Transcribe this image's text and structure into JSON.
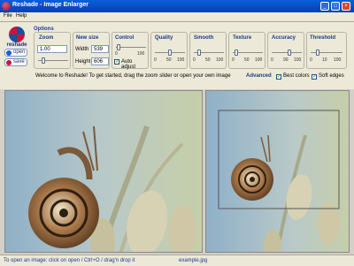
{
  "window": {
    "title": "Reshade - Image Enlarger"
  },
  "menu": {
    "file": "File",
    "help": "Help"
  },
  "sidebar": {
    "logo_text": "reshade",
    "open_label": "open",
    "save_label": "save"
  },
  "options": {
    "label": "Options",
    "zoom": {
      "label": "Zoom",
      "value": "1.00"
    },
    "newsize": {
      "label": "New size",
      "width_label": "Width",
      "width_value": "539",
      "height_label": "Height",
      "height_value": "606"
    },
    "control": {
      "label": "Control",
      "min": "0",
      "max": "100",
      "auto_adjust_label": "Auto adjust",
      "auto_adjust": true
    },
    "quality": {
      "label": "Quality",
      "ticks": [
        "0",
        "50",
        "100"
      ]
    },
    "smooth": {
      "label": "Smooth",
      "ticks": [
        "0",
        "50",
        "100"
      ]
    },
    "texture": {
      "label": "Texture",
      "ticks": [
        "0",
        "50",
        "100"
      ]
    },
    "accuracy": {
      "label": "Accuracy",
      "ticks": [
        "0",
        "90",
        "100"
      ]
    },
    "threshold": {
      "label": "Threshold",
      "ticks": [
        "0",
        "10",
        "100"
      ]
    }
  },
  "welcome_text": "Welcome to Reshade! To get started, drag the zoom slider or open your own image",
  "advanced": {
    "label": "Advanced",
    "best_colors_label": "Best colors",
    "best_colors": true,
    "soft_edges_label": "Soft edges",
    "soft_edges": true
  },
  "status": {
    "hint": "To open an image: click on open / Ctrl+O / drag'n drop it",
    "filename": "example.jpg"
  },
  "colors": {
    "title_bar": "#0a5fd8",
    "panel": "#ece9d8",
    "accent": "#1b3a8c"
  }
}
